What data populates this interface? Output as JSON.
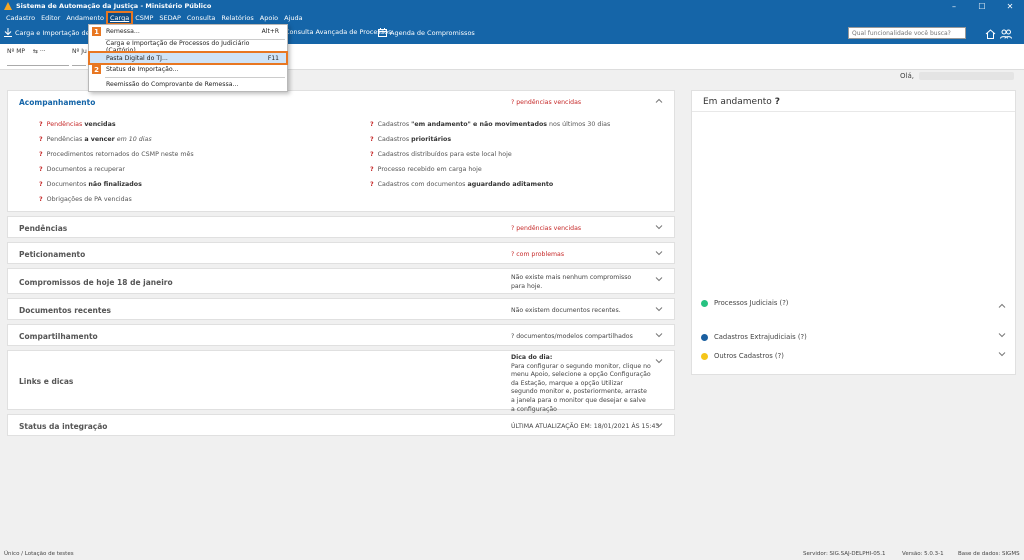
{
  "window": {
    "title": "Sistema de Automação da Justiça - Ministério Público"
  },
  "menu": [
    "Cadastro",
    "Editor",
    "Andamento",
    "Carga",
    "CSMP",
    "SEDAP",
    "Consulta",
    "Relatórios",
    "Apoio",
    "Ajuda"
  ],
  "toolbar": {
    "item1": "Carga e Importação de Pro",
    "item2": "Consulta Avançada de Processos",
    "item3": "Agenda de Compromissos",
    "search_placeholder": "Qual funcionalidade você busca?"
  },
  "subbar": {
    "nmp_label": "Nº MP",
    "ja_label": "Nº Ju",
    "arrows": "⇆ ···"
  },
  "dropdown": {
    "items": [
      {
        "label": "Remessa...",
        "shortcut": "Alt+R"
      },
      {
        "label": "Carga e Importação de Processos do Judiciário (Cartório)..."
      },
      {
        "label": "Pasta Digital do TJ...",
        "shortcut": "F11"
      },
      {
        "label": "Status de Importação..."
      },
      {
        "label": "Reemissão do Comprovante de Remessa..."
      }
    ],
    "badge1": "1",
    "badge2": "2"
  },
  "greeting": "Olá,",
  "acompanhamento": {
    "title": "Acompanhamento",
    "side": "? pendências vencidas",
    "col1": [
      {
        "a": "Pendências ",
        "b": "vencidas",
        "c": "",
        "red": true
      },
      {
        "a": "Pendências ",
        "b": "a vencer",
        "c": " em 10 dias"
      },
      {
        "a": "Procedimentos retornados do CSMP neste mês",
        "b": "",
        "c": ""
      },
      {
        "a": "Documentos a recuperar",
        "b": "",
        "c": ""
      },
      {
        "a": "Documentos ",
        "b": "não finalizados",
        "c": ""
      },
      {
        "a": "Obrigações de PA vencidas",
        "b": "",
        "c": ""
      }
    ],
    "col2": [
      {
        "a": "Cadastros ",
        "b": "\"em andamento\" e não movimentados",
        "c": " nos últimos 30 dias"
      },
      {
        "a": "Cadastros ",
        "b": "prioritários",
        "c": ""
      },
      {
        "a": "Cadastros distribuídos para este local hoje",
        "b": "",
        "c": ""
      },
      {
        "a": "Processo recebido em carga hoje",
        "b": "",
        "c": ""
      },
      {
        "a": "Cadastros com documentos ",
        "b": "aguardando aditamento",
        "c": ""
      }
    ],
    "q": "?"
  },
  "cards": {
    "pendencias": {
      "title": "Pendências",
      "side": "? pendências vencidas"
    },
    "peticionamento": {
      "title": "Peticionamento",
      "side": "? com problemas"
    },
    "compromissos": {
      "title": "Compromissos de hoje 18 de janeiro",
      "side": "Não existe mais nenhum compromisso para hoje."
    },
    "documentos": {
      "title": "Documentos recentes",
      "side": "Não existem documentos recentes."
    },
    "compartilhamento": {
      "title": "Compartilhamento",
      "side": "? documentos/modelos compartilhados"
    },
    "links": {
      "title": "Links e dicas",
      "tip_title": "Dica do dia:",
      "tip": "Para configurar o segundo monitor, clique no menu Apoio, selecione a opção Configuração da Estação, marque a opção Utilizar segundo monitor e, posteriormente, arraste a janela para o monitor que desejar e salve a configuração"
    },
    "status": {
      "title": "Status da integração",
      "side": "ÚLTIMA ATUALIZAÇÃO EM: 18/01/2021 ÀS 15:43"
    }
  },
  "right": {
    "title": "Em andamento",
    "q": "?",
    "legend": [
      {
        "label": "Processos Judiciais (?)",
        "color": "#26c281"
      },
      {
        "label": "Cadastros Extrajudiciais (?)",
        "color": "#1a5fa0"
      },
      {
        "label": "Outros Cadastros (?)",
        "color": "#f5c518"
      }
    ]
  },
  "status": {
    "left": "Único / Lotação de testes",
    "server": "Servidor: SIG.SAJ-DELPHI-05.1",
    "version": "Versão: 5.0.3-1",
    "db": "Base de dados: SIGMS"
  },
  "colors": {
    "primary": "#1565a8",
    "highlight": "#e87722",
    "red": "#c62828"
  }
}
